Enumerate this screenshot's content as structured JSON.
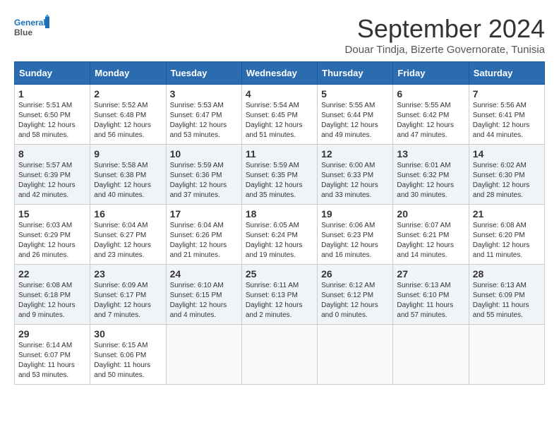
{
  "logo": {
    "line1": "General",
    "line2": "Blue"
  },
  "title": "September 2024",
  "subtitle": "Douar Tindja, Bizerte Governorate, Tunisia",
  "days_header": [
    "Sunday",
    "Monday",
    "Tuesday",
    "Wednesday",
    "Thursday",
    "Friday",
    "Saturday"
  ],
  "weeks": [
    [
      {
        "day": "1",
        "info": "Sunrise: 5:51 AM\nSunset: 6:50 PM\nDaylight: 12 hours\nand 58 minutes."
      },
      {
        "day": "2",
        "info": "Sunrise: 5:52 AM\nSunset: 6:48 PM\nDaylight: 12 hours\nand 56 minutes."
      },
      {
        "day": "3",
        "info": "Sunrise: 5:53 AM\nSunset: 6:47 PM\nDaylight: 12 hours\nand 53 minutes."
      },
      {
        "day": "4",
        "info": "Sunrise: 5:54 AM\nSunset: 6:45 PM\nDaylight: 12 hours\nand 51 minutes."
      },
      {
        "day": "5",
        "info": "Sunrise: 5:55 AM\nSunset: 6:44 PM\nDaylight: 12 hours\nand 49 minutes."
      },
      {
        "day": "6",
        "info": "Sunrise: 5:55 AM\nSunset: 6:42 PM\nDaylight: 12 hours\nand 47 minutes."
      },
      {
        "day": "7",
        "info": "Sunrise: 5:56 AM\nSunset: 6:41 PM\nDaylight: 12 hours\nand 44 minutes."
      }
    ],
    [
      {
        "day": "8",
        "info": "Sunrise: 5:57 AM\nSunset: 6:39 PM\nDaylight: 12 hours\nand 42 minutes."
      },
      {
        "day": "9",
        "info": "Sunrise: 5:58 AM\nSunset: 6:38 PM\nDaylight: 12 hours\nand 40 minutes."
      },
      {
        "day": "10",
        "info": "Sunrise: 5:59 AM\nSunset: 6:36 PM\nDaylight: 12 hours\nand 37 minutes."
      },
      {
        "day": "11",
        "info": "Sunrise: 5:59 AM\nSunset: 6:35 PM\nDaylight: 12 hours\nand 35 minutes."
      },
      {
        "day": "12",
        "info": "Sunrise: 6:00 AM\nSunset: 6:33 PM\nDaylight: 12 hours\nand 33 minutes."
      },
      {
        "day": "13",
        "info": "Sunrise: 6:01 AM\nSunset: 6:32 PM\nDaylight: 12 hours\nand 30 minutes."
      },
      {
        "day": "14",
        "info": "Sunrise: 6:02 AM\nSunset: 6:30 PM\nDaylight: 12 hours\nand 28 minutes."
      }
    ],
    [
      {
        "day": "15",
        "info": "Sunrise: 6:03 AM\nSunset: 6:29 PM\nDaylight: 12 hours\nand 26 minutes."
      },
      {
        "day": "16",
        "info": "Sunrise: 6:04 AM\nSunset: 6:27 PM\nDaylight: 12 hours\nand 23 minutes."
      },
      {
        "day": "17",
        "info": "Sunrise: 6:04 AM\nSunset: 6:26 PM\nDaylight: 12 hours\nand 21 minutes."
      },
      {
        "day": "18",
        "info": "Sunrise: 6:05 AM\nSunset: 6:24 PM\nDaylight: 12 hours\nand 19 minutes."
      },
      {
        "day": "19",
        "info": "Sunrise: 6:06 AM\nSunset: 6:23 PM\nDaylight: 12 hours\nand 16 minutes."
      },
      {
        "day": "20",
        "info": "Sunrise: 6:07 AM\nSunset: 6:21 PM\nDaylight: 12 hours\nand 14 minutes."
      },
      {
        "day": "21",
        "info": "Sunrise: 6:08 AM\nSunset: 6:20 PM\nDaylight: 12 hours\nand 11 minutes."
      }
    ],
    [
      {
        "day": "22",
        "info": "Sunrise: 6:08 AM\nSunset: 6:18 PM\nDaylight: 12 hours\nand 9 minutes."
      },
      {
        "day": "23",
        "info": "Sunrise: 6:09 AM\nSunset: 6:17 PM\nDaylight: 12 hours\nand 7 minutes."
      },
      {
        "day": "24",
        "info": "Sunrise: 6:10 AM\nSunset: 6:15 PM\nDaylight: 12 hours\nand 4 minutes."
      },
      {
        "day": "25",
        "info": "Sunrise: 6:11 AM\nSunset: 6:13 PM\nDaylight: 12 hours\nand 2 minutes."
      },
      {
        "day": "26",
        "info": "Sunrise: 6:12 AM\nSunset: 6:12 PM\nDaylight: 12 hours\nand 0 minutes."
      },
      {
        "day": "27",
        "info": "Sunrise: 6:13 AM\nSunset: 6:10 PM\nDaylight: 11 hours\nand 57 minutes."
      },
      {
        "day": "28",
        "info": "Sunrise: 6:13 AM\nSunset: 6:09 PM\nDaylight: 11 hours\nand 55 minutes."
      }
    ],
    [
      {
        "day": "29",
        "info": "Sunrise: 6:14 AM\nSunset: 6:07 PM\nDaylight: 11 hours\nand 53 minutes."
      },
      {
        "day": "30",
        "info": "Sunrise: 6:15 AM\nSunset: 6:06 PM\nDaylight: 11 hours\nand 50 minutes."
      },
      {
        "day": "",
        "info": ""
      },
      {
        "day": "",
        "info": ""
      },
      {
        "day": "",
        "info": ""
      },
      {
        "day": "",
        "info": ""
      },
      {
        "day": "",
        "info": ""
      }
    ]
  ]
}
